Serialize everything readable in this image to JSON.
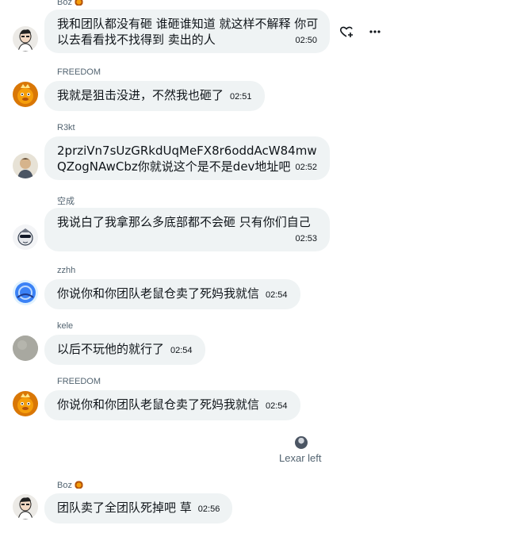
{
  "messages": [
    {
      "sender": "Boz",
      "text": "我和团队都没有砸 谁砸谁知道 就这样不解释 你可以去看看找不找得到 卖出的人",
      "time": "02:50",
      "avatar": "boz-avatar"
    },
    {
      "sender": "FREEDOM",
      "text": "我就是狙击没进，不然我也砸了",
      "time": "02:51",
      "avatar": "freedom-avatar"
    },
    {
      "sender": "R3kt",
      "text": "2prziVn7sUzGRkdUqMeFX8r6oddAcW84mwQZogNAwCbz你就说这个是不是dev地址吧",
      "time": "02:52",
      "avatar": "r3kt-avatar"
    },
    {
      "sender": "空成",
      "text": "我说白了我拿那么多底部都不会砸 只有你们自己",
      "time": "02:53",
      "avatar": "kongcheng-avatar"
    },
    {
      "sender": "zzhh",
      "text": "你说你和你团队老鼠仓卖了死妈我就信",
      "time": "02:54",
      "avatar": "zzhh-avatar"
    },
    {
      "sender": "kele",
      "text": "以后不玩他的就行了",
      "time": "02:54",
      "avatar": "kele-avatar"
    },
    {
      "sender": "FREEDOM",
      "text": "你说你和你团队老鼠仓卖了死妈我就信",
      "time": "02:54",
      "avatar": "freedom-avatar"
    },
    {
      "sender": "Boz",
      "text": "团队卖了全团队死掉吧 草",
      "time": "02:56",
      "avatar": "boz-avatar"
    }
  ],
  "system_notice": {
    "text": "Lexar left",
    "icon": "user-avatar-icon"
  },
  "message_actions": {
    "react_icon": "heart-plus-icon",
    "more_icon": "more-horizontal-icon"
  },
  "colors": {
    "bubble": "#eff3f4",
    "meta": "#536471",
    "text": "#0f1419",
    "freedom_avatar": "#f59e0b",
    "zzhh_avatar": "#3b82f6"
  }
}
